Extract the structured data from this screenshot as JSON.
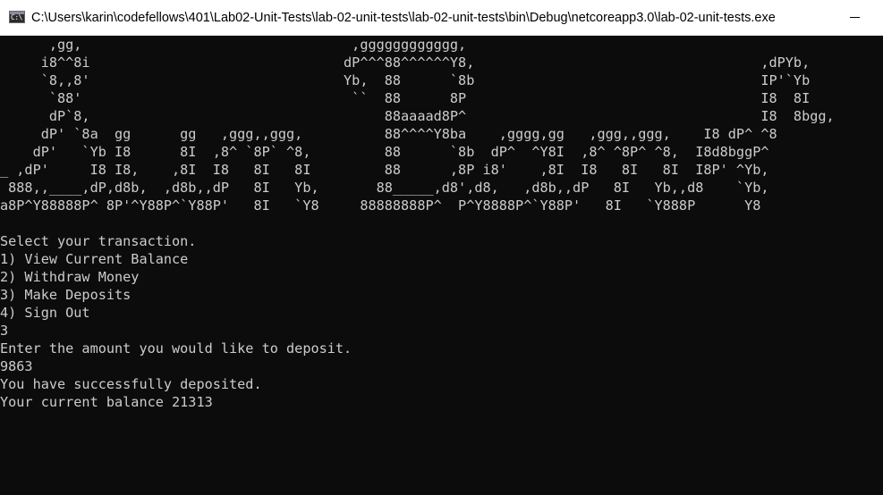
{
  "window": {
    "title": "C:\\Users\\karin\\codefellows\\401\\Lab02-Unit-Tests\\lab-02-unit-tests\\lab-02-unit-tests\\bin\\Debug\\netcoreapp3.0\\lab-02-unit-tests.exe",
    "icon_name": "console-app-icon",
    "icon_glyph": "C:\\",
    "minimize_glyph": "minimize-icon"
  },
  "console": {
    "text_color": "#cccccc",
    "background": "#0c0c0c",
    "banner": [
      "      ,gg,                                 ,gggggggggggg,",
      "     i8^^8i                               dP^^^88^^^^^^Y8,                                   ,dPYb,",
      "     `8,,8'                               Yb,  88      `8b                                   IP'`Yb",
      "      `88'                                 ``  88      8P                                    I8  8I",
      "      dP`8,                                    88aaaad8P^                                    I8  8bgg,",
      "     dP' `8a  gg      gg   ,ggg,,ggg,          88^^^^Y8ba    ,gggg,gg   ,ggg,,ggg,    I8 dP^ ^8",
      "    dP'   `Yb I8      8I  ,8^ `8P` ^8,         88      `8b  dP^  ^Y8I  ,8^ ^8P^ ^8,  I8d8bggP^",
      "_ ,dP'     I8 I8,    ,8I  I8   8I   8I         88      ,8P i8'    ,8I  I8   8I   8I  I8P' ^Yb,",
      " 888,,____,dP,d8b,  ,d8b,,dP   8I   Yb,       88_____,d8',d8,   ,d8b,,dP   8I   Yb,,d8    `Yb,",
      "a8P^Y88888P^ 8P'^Y88P^`Y88P'   8I   `Y8     88888888P^  P^Y8888P^`Y88P'   8I   `Y888P      Y8"
    ],
    "blank": "",
    "prompt": "Select your transaction.",
    "menu": [
      "1) View Current Balance",
      "2) Withdraw Money",
      "3) Make Deposits",
      "4) Sign Out"
    ],
    "menu_choice": "3",
    "deposit_prompt": "Enter the amount you would like to deposit.",
    "deposit_amount": "9863",
    "success_message": "You have successfully deposited.",
    "balance_message": "Your current balance 21313"
  }
}
